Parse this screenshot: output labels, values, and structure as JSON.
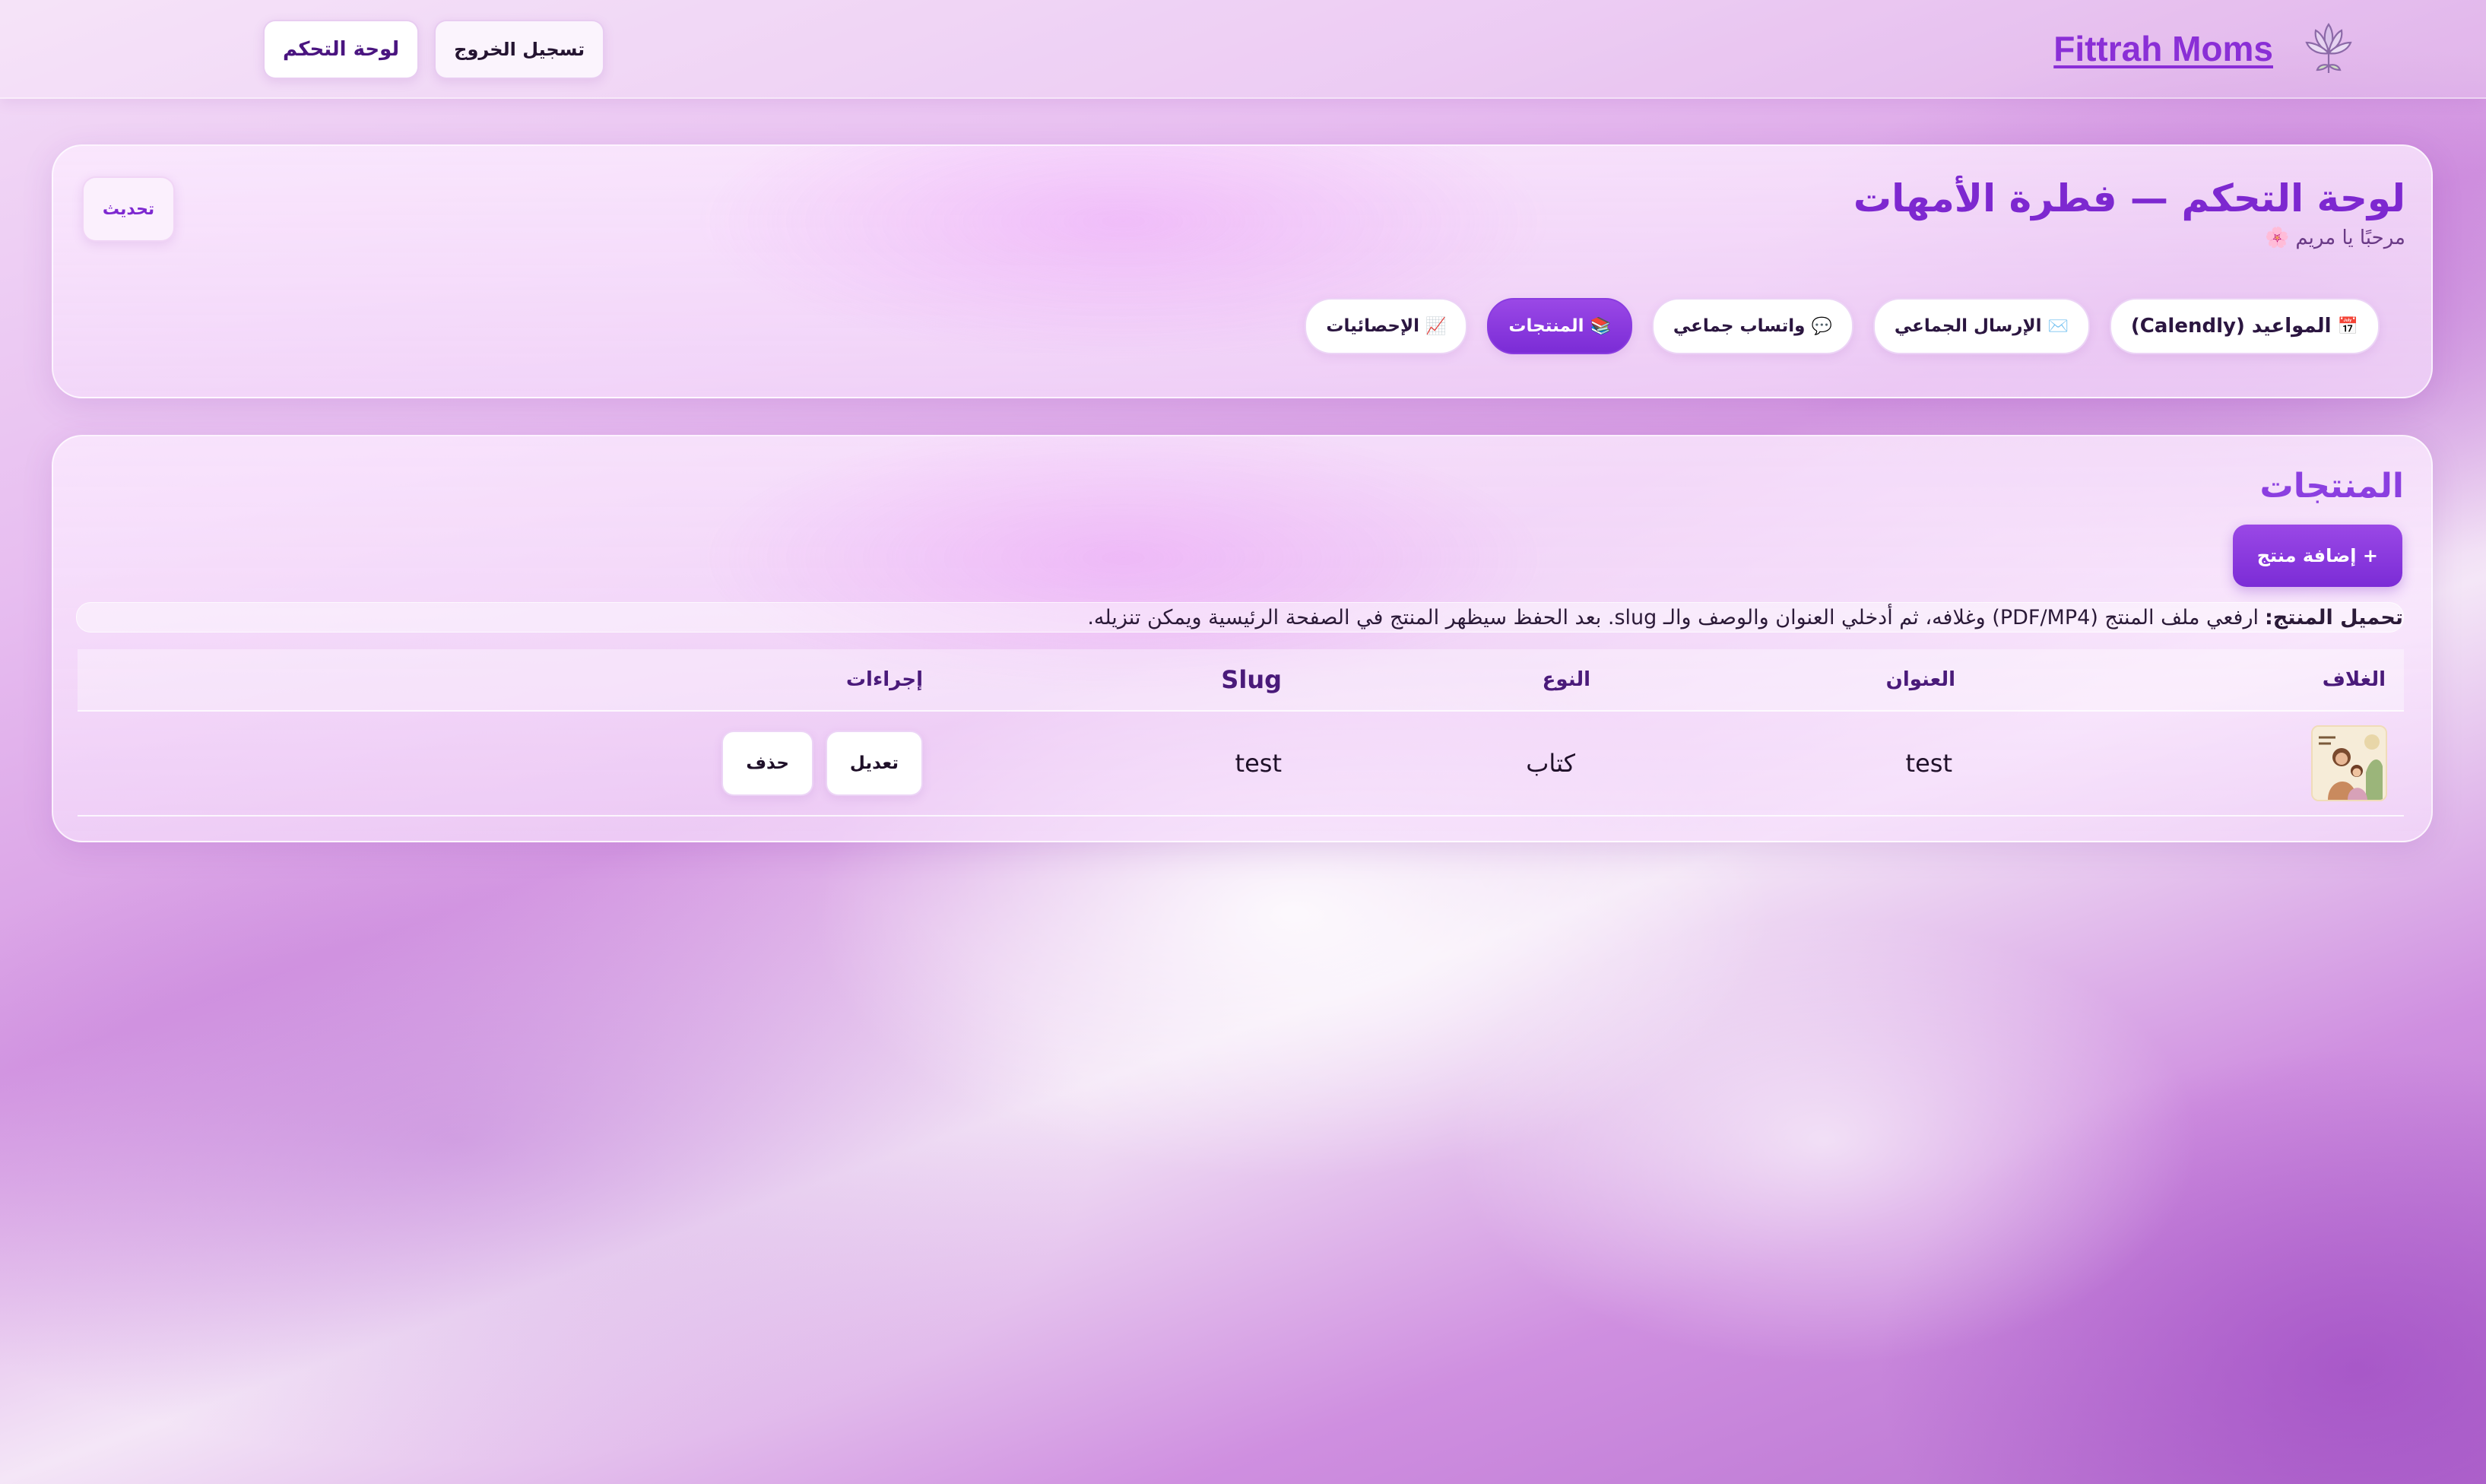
{
  "header": {
    "brand_name": "Fittrah Moms",
    "logo_icon": "lotus-logo-icon",
    "dashboard_button": "لوحة التحكم",
    "logout_button": "تسجيل الخروج"
  },
  "dashboard": {
    "title": "لوحة التحكم — فطرة الأمهات",
    "welcome": "مرحبًا يا مريم",
    "welcome_icon": "🌸",
    "refresh_button": "تحديث",
    "tabs": [
      {
        "icon": "📅",
        "label": "المواعيد (Calendly)",
        "active": false
      },
      {
        "icon": "✉️",
        "label": "الإرسال الجماعي",
        "active": false
      },
      {
        "icon": "💬",
        "label": "واتساب جماعي",
        "active": false
      },
      {
        "icon": "📚",
        "label": "المنتجات",
        "active": true
      },
      {
        "icon": "📈",
        "label": "الإحصائيات",
        "active": false
      }
    ]
  },
  "products": {
    "title": "المنتجات",
    "add_button": "+ إضافة منتج",
    "note_strong": "تحميل المنتج:",
    "note_text": "ارفعي ملف المنتج (PDF/MP4) وغلافه، ثم أدخلي العنوان والوصف والـ slug. بعد الحفظ سيظهر المنتج في الصفحة الرئيسية ويمكن تنزيله.",
    "columns": {
      "cover": "الغلاف",
      "title": "العنوان",
      "type": "النوع",
      "slug": "Slug",
      "actions": "إجراءات"
    },
    "rows": [
      {
        "title": "test",
        "type": "كتاب",
        "slug": "test",
        "edit_button": "تعديل",
        "delete_button": "حذف"
      }
    ]
  },
  "colors": {
    "accent": "#7b2cd6",
    "brand": "#8a2fd6",
    "title": "#7d28d0"
  }
}
